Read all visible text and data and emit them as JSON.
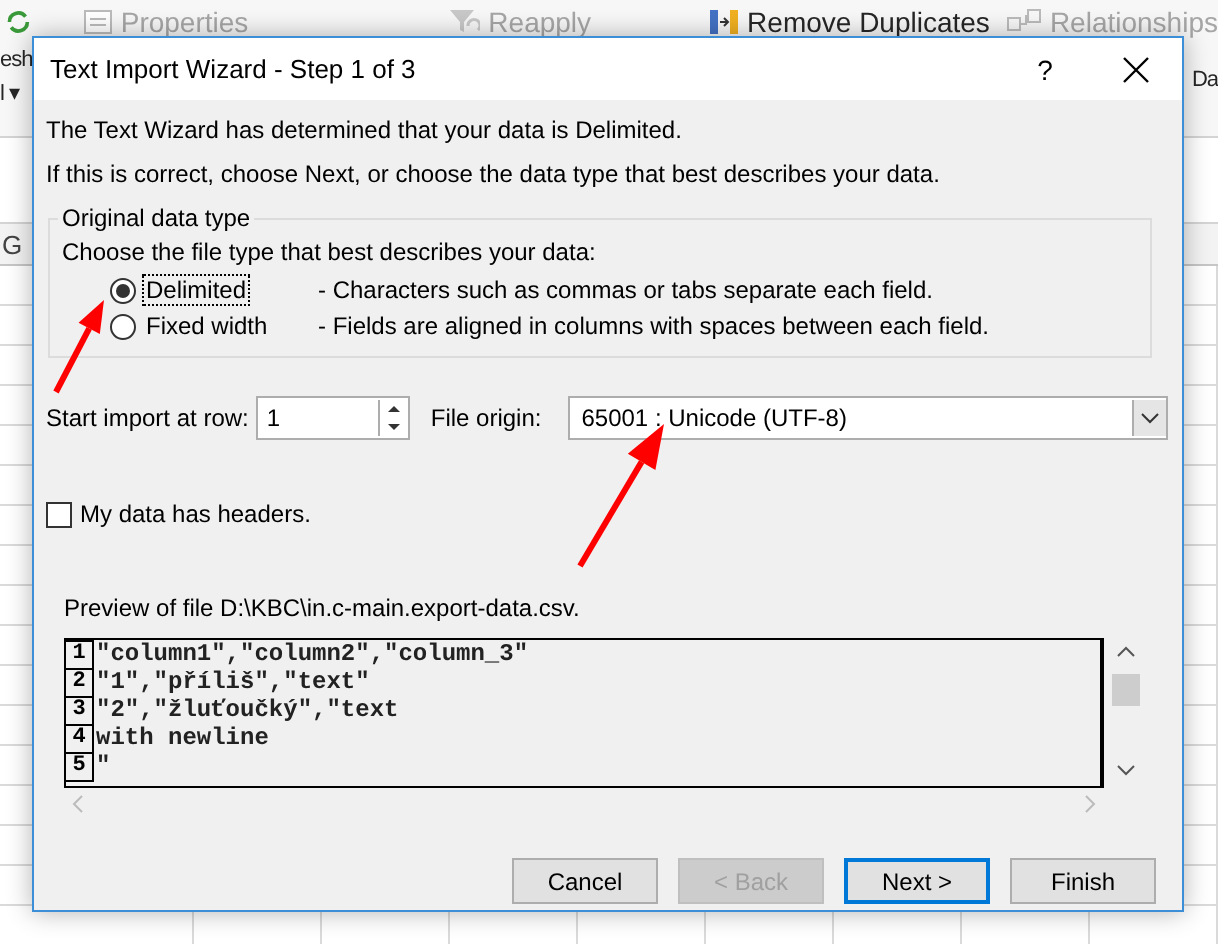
{
  "ribbon": {
    "items": [
      {
        "kind": "properties",
        "label": "Properties",
        "disabled": true
      },
      {
        "kind": "reapply",
        "label": "Reapply",
        "disabled": true
      },
      {
        "kind": "duplicates",
        "label": "Remove Duplicates",
        "disabled": false
      },
      {
        "kind": "relationships",
        "label": "Relationships",
        "disabled": true
      }
    ],
    "left_labels": [
      "esh",
      "l ▾"
    ],
    "right_label": "Da",
    "column_header": "G"
  },
  "dialog": {
    "title": "Text Import Wizard - Step 1 of 3",
    "help": "?",
    "intro": [
      "The Text Wizard has determined that your data is Delimited.",
      "If this is correct, choose Next, or choose the data type that best describes your data."
    ],
    "data_type": {
      "legend": "Original data type",
      "prompt": "Choose the file type that best describes your data:",
      "options": [
        {
          "label": "Delimited",
          "description": "- Characters such as commas or tabs separate each field.",
          "selected": true
        },
        {
          "label": "Fixed width",
          "description": "- Fields are aligned in columns with spaces between each field.",
          "selected": false
        }
      ]
    },
    "start_row": {
      "label": "Start import at row:",
      "value": "1"
    },
    "file_origin": {
      "label": "File origin:",
      "value": "65001 : Unicode (UTF-8)"
    },
    "headers_checkbox": {
      "label": "My data has headers.",
      "checked": false
    },
    "preview": {
      "label": "Preview of file D:\\KBC\\in.c-main.export-data.csv.",
      "lines": [
        {
          "number": "1",
          "text": "\"column1\",\"column2\",\"column_3\""
        },
        {
          "number": "2",
          "text": "\"1\",\"příliš\",\"text\""
        },
        {
          "number": "3",
          "text": "\"2\",\"žluťoučký\",\"text"
        },
        {
          "number": "4",
          "text": "with newline"
        },
        {
          "number": "5",
          "text": "\""
        }
      ]
    },
    "buttons": [
      {
        "label": "Cancel",
        "disabled": false,
        "default": false
      },
      {
        "label": "< Back",
        "disabled": true,
        "default": false
      },
      {
        "label": "Next >",
        "disabled": false,
        "default": true
      },
      {
        "label": "Finish",
        "disabled": false,
        "default": false
      }
    ]
  },
  "annotations": [
    {
      "kind": "arrow"
    },
    {
      "kind": "arrow"
    }
  ]
}
